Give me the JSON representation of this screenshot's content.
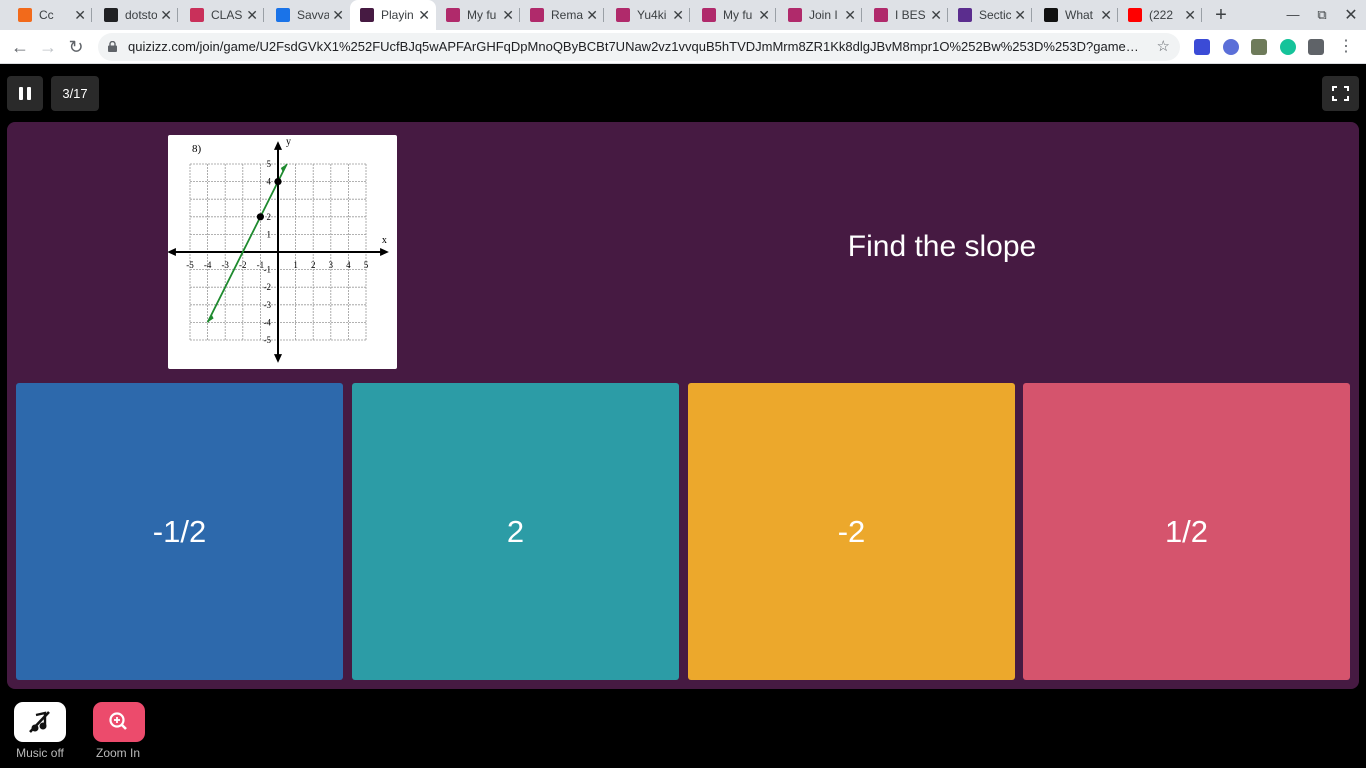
{
  "browser": {
    "tabs": [
      {
        "title": "Cc",
        "favicon_color": "#f26a1b"
      },
      {
        "title": "dotstorm",
        "favicon_color": "#202124"
      },
      {
        "title": "CLASSROOM",
        "favicon_color": "#c9305a"
      },
      {
        "title": "Savvas",
        "favicon_color": "#1a73e8"
      },
      {
        "title": "Playing",
        "favicon_color": "#461a42"
      },
      {
        "title": "My fu",
        "favicon_color": "#b02a6b"
      },
      {
        "title": "Rema",
        "favicon_color": "#b02a6b"
      },
      {
        "title": "Yu4ki",
        "favicon_color": "#b02a6b"
      },
      {
        "title": "My fu",
        "favicon_color": "#b02a6b"
      },
      {
        "title": "Join I",
        "favicon_color": "#b02a6b"
      },
      {
        "title": "I BES",
        "favicon_color": "#b02a6b"
      },
      {
        "title": "Sectic",
        "favicon_color": "#5b2d8e"
      },
      {
        "title": "What",
        "favicon_color": "#111111"
      },
      {
        "title": "(222",
        "favicon_color": "#ff0000"
      }
    ],
    "url": "quizizz.com/join/game/U2FsdGVkX1%252FUcfBJq5wAPFArGHFqDpMnoQByBCBt7UNaw2vz1vvquB5hTVDJmMrm8ZR1Kk8dlgJBvM8mpr1O%252Bw%253D%253D?gameType=as..."
  },
  "quiz": {
    "question_counter": "3/17",
    "question_text": "Find the slope",
    "graph": {
      "problem_number": "8)",
      "x_axis_label": "x",
      "y_axis_label": "y",
      "x_ticks": [
        "-5",
        "-4",
        "-3",
        "-2",
        "-1",
        "1",
        "2",
        "3",
        "4",
        "5"
      ],
      "y_ticks": [
        "5",
        "4",
        "2",
        "1",
        "-1",
        "-2",
        "-3",
        "-4",
        "-5"
      ],
      "line_points": [
        [
          -1,
          2
        ],
        [
          0,
          4
        ]
      ],
      "line_color": "#1e8a2e"
    },
    "options": [
      {
        "label": "-1/2",
        "color": "#2d69ac"
      },
      {
        "label": "2",
        "color": "#2c9ca6"
      },
      {
        "label": "-2",
        "color": "#eca82c"
      },
      {
        "label": "1/2",
        "color": "#d5546d"
      }
    ]
  },
  "controls": {
    "music_label": "Music off",
    "zoom_label": "Zoom In",
    "zoom_color": "#ec4b6c"
  }
}
